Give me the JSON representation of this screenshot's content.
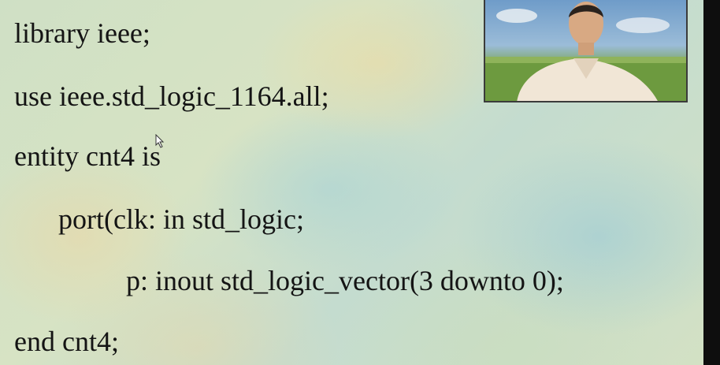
{
  "slide": {
    "code_lines": [
      "library ieee;",
      "use ieee.std_logic_1164.all;",
      "entity cnt4 is",
      "port(clk: in std_logic;",
      "p: inout std_logic_vector(3 downto 0);",
      "end cnt4;"
    ]
  },
  "colors": {
    "text": "#141414",
    "background_tint": "#cfe0c5"
  },
  "icons": {
    "cursor": "mouse-pointer-icon",
    "video": "presenter-video-thumbnail"
  }
}
